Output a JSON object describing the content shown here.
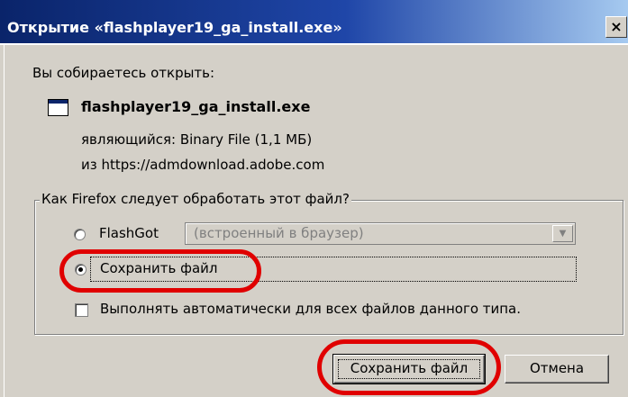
{
  "window": {
    "title": "Открытие «flashplayer19_ga_install.exe»",
    "close_label": "×"
  },
  "dialog": {
    "prompt": "Вы собираетесь открыть:",
    "file_icon": "application-window-icon",
    "file_name": "flashplayer19_ga_install.exe",
    "type_line": "являющийся:  Binary File (1,1 МБ)",
    "from_line": "из  https://admdownload.adobe.com"
  },
  "action_group": {
    "legend": "Как Firefox следует обработать этот файл?",
    "options": [
      {
        "label": "FlashGot",
        "checked": false
      },
      {
        "label": "Сохранить файл",
        "checked": true
      }
    ],
    "flashgot_select_value": "(встроенный в браузер)",
    "auto_checkbox_label": "Выполнять автоматически для всех файлов данного типа.",
    "auto_checked": false
  },
  "buttons": {
    "save_label": "Сохранить файл",
    "cancel_label": "Отмена"
  },
  "colors": {
    "titlebar_start": "#0a246a",
    "titlebar_end": "#a6caf0",
    "face": "#d4d0c8",
    "annotation_red": "#e00000"
  }
}
